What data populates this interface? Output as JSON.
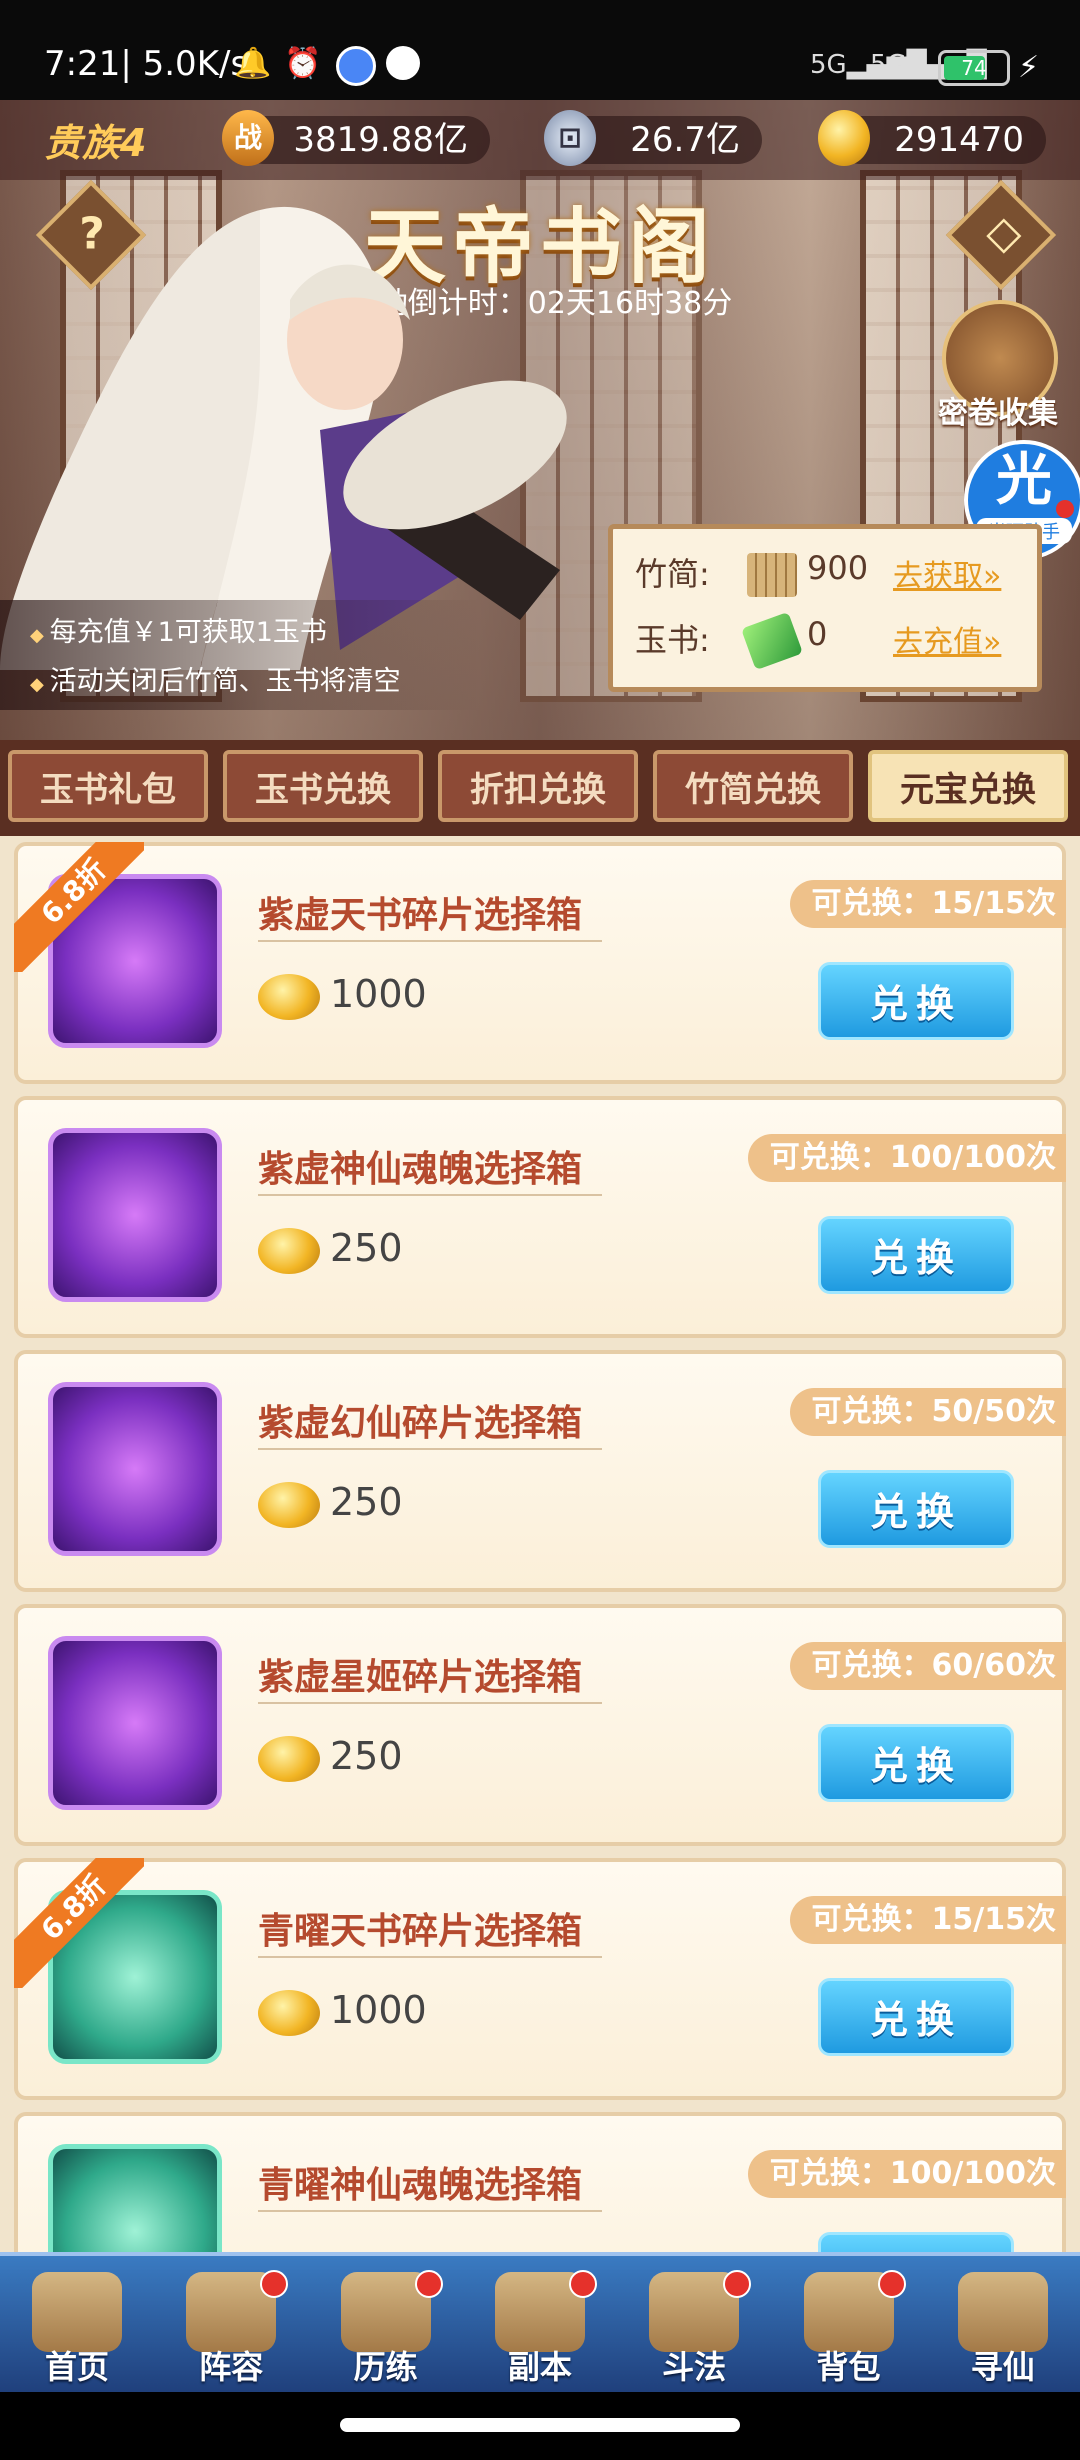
{
  "status_bar": {
    "time": "7:21",
    "speed": "| 5.0K/s",
    "network1": "5G",
    "network2": "5G",
    "battery": "74"
  },
  "header": {
    "noble": "贵族4",
    "power_badge": "战",
    "power": "3819.88亿",
    "silver": "26.7亿",
    "gold": "291470"
  },
  "banner": {
    "title": "天帝书阁",
    "countdown": "活动倒计时：02天16时38分",
    "help_icon": "?",
    "back_icon": "◇",
    "scroll_label": "密卷收集",
    "helper_glyph": "光",
    "helper_label": "光环助手",
    "notes": [
      "每充值￥1可获取1玉书",
      "活动关闭后竹简、玉书将清空"
    ]
  },
  "currency_panel": {
    "bamboo_label": "竹简:",
    "bamboo_value": "900",
    "bamboo_link": "去获取»",
    "jade_label": "玉书:",
    "jade_value": "0",
    "jade_link": "去充值»"
  },
  "tabs": [
    {
      "label": "玉书礼包",
      "active": false
    },
    {
      "label": "玉书兑换",
      "active": false
    },
    {
      "label": "折扣兑换",
      "active": false
    },
    {
      "label": "竹简兑换",
      "active": false
    },
    {
      "label": "元宝兑换",
      "active": true
    }
  ],
  "items": [
    {
      "name": "紫虚天书碎片选择箱",
      "price": "1000",
      "quota": "可兑换：15/15次",
      "button": "兑换",
      "discount": "6.8折",
      "icon": "purple"
    },
    {
      "name": "紫虚神仙魂魄选择箱",
      "price": "250",
      "quota": "可兑换：100/100次",
      "button": "兑换",
      "discount": "",
      "icon": "purple"
    },
    {
      "name": "紫虚幻仙碎片选择箱",
      "price": "250",
      "quota": "可兑换：50/50次",
      "button": "兑换",
      "discount": "",
      "icon": "purple"
    },
    {
      "name": "紫虚星姬碎片选择箱",
      "price": "250",
      "quota": "可兑换：60/60次",
      "button": "兑换",
      "discount": "",
      "icon": "purple"
    },
    {
      "name": "青曜天书碎片选择箱",
      "price": "1000",
      "quota": "可兑换：15/15次",
      "button": "兑换",
      "discount": "6.8折",
      "icon": "green"
    },
    {
      "name": "青曜神仙魂魄选择箱",
      "price": "",
      "quota": "可兑换：100/100次",
      "button": "兑换",
      "discount": "",
      "icon": "green"
    }
  ],
  "bottom_nav": [
    {
      "label": "首页",
      "dot": false
    },
    {
      "label": "阵容",
      "dot": true
    },
    {
      "label": "历练",
      "dot": true
    },
    {
      "label": "副本",
      "dot": true
    },
    {
      "label": "斗法",
      "dot": true
    },
    {
      "label": "背包",
      "dot": true
    },
    {
      "label": "寻仙",
      "dot": false
    }
  ],
  "colors": {
    "accent_blue": "#1f9ae0",
    "title_red": "#b54a2e",
    "gold": "#f2b524",
    "discount_orange": "#ef7a22"
  }
}
